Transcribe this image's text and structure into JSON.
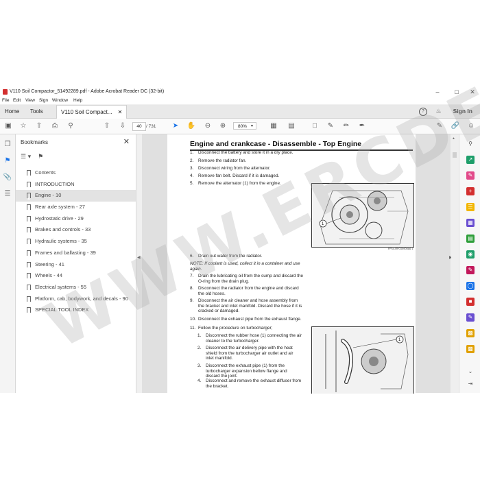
{
  "window": {
    "title": "V110 Soil Compactor_51492289.pdf - Adobe Acrobat Reader DC (32-bit)",
    "menu": [
      "File",
      "Edit",
      "View",
      "Sign",
      "Window",
      "Help"
    ]
  },
  "tabs": {
    "home": "Home",
    "tools": "Tools",
    "document": "V110 Soil Compact...",
    "sign_in": "Sign In"
  },
  "toolbar": {
    "page_current": "40",
    "page_total": "/ 731",
    "zoom": "80%"
  },
  "bookmarks": {
    "header": "Bookmarks",
    "items": [
      {
        "label": "Contents"
      },
      {
        "label": "INTRODUCTION"
      },
      {
        "label": "Engine - 10"
      },
      {
        "label": "Rear axle system - 27"
      },
      {
        "label": "Hydrostatic drive - 29"
      },
      {
        "label": "Brakes and controls - 33"
      },
      {
        "label": "Hydraulic systems - 35"
      },
      {
        "label": "Frames and ballasting - 39"
      },
      {
        "label": "Steering - 41"
      },
      {
        "label": "Wheels - 44"
      },
      {
        "label": "Electrical systems - 55"
      },
      {
        "label": "Platform, cab, bodywork, and decals - 90"
      },
      {
        "label": "SPECIAL TOOL INDEX"
      }
    ],
    "selected_index": 2
  },
  "document": {
    "heading": "Engine and crankcase - Disassemble - Top Engine",
    "steps_a": [
      {
        "n": "1.",
        "t": "Disconnect the battery and store it in a dry place."
      },
      {
        "n": "2.",
        "t": "Remove the radiator fan."
      },
      {
        "n": "3.",
        "t": "Disconnect wiring from the alternator."
      },
      {
        "n": "4.",
        "t": "Remove fan belt. Discard if it is damaged."
      },
      {
        "n": "5.",
        "t": "Remove the alternator (1) from the engine."
      }
    ],
    "fig1_caption": "FP14-RFC05900A6 1",
    "step6": {
      "n": "6.",
      "t": "Drain out water from the radiator."
    },
    "note": "NOTE: If coolant is used, collect it in a container and use again.",
    "steps_b": [
      {
        "n": "7.",
        "t": "Drain the lubricating oil from the sump and discard the O-ring from the drain plug."
      },
      {
        "n": "8.",
        "t": "Disconnect the radiator from the engine and discard the old hoses."
      },
      {
        "n": "9.",
        "t": "Disconnect the air cleaner and hose assembly from the bracket and inlet manifold. Discard the hose if it is cracked or damaged."
      },
      {
        "n": "10.",
        "t": "Disconnect the exhaust pipe from the exhaust flange."
      },
      {
        "n": "11.",
        "t": "Follow the procedure on turbocharger;"
      }
    ],
    "substeps": [
      {
        "n": "1.",
        "t": "Disconnect the rubber hose (1) connecting the air cleaner to the turbocharger."
      },
      {
        "n": "2.",
        "t": "Disconnect the air delivery pipe with the heat shield from the turbocharger air outlet and air inlet manifold."
      },
      {
        "n": "3.",
        "t": "Disconnect the exhaust pipe (1) from the turbocharger expansion bellow flange and discard the joint."
      },
      {
        "n": "4.",
        "t": "Disconnect and remove the exhaust diffuser from the bracket."
      }
    ],
    "callout": "1"
  },
  "watermark": "WWW.ERCDEAR.COM",
  "colors": {
    "acrobat_red": "#d32f2f",
    "accent_blue": "#1a73e8"
  }
}
